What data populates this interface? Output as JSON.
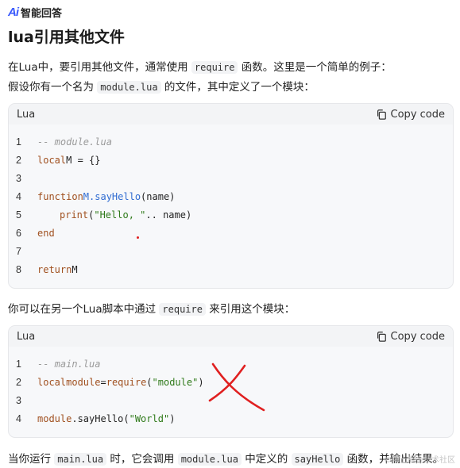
{
  "brand": {
    "logo": "Ai",
    "name": "智能回答"
  },
  "title": "lua引用其他文件",
  "intro": {
    "p1_before": "在Lua中，要引用其他文件，通常使用 ",
    "p1_code": "require",
    "p1_after": " 函数。这里是一个简单的例子：",
    "p2_before": "假设你有一个名为 ",
    "p2_code": "module.lua",
    "p2_after": " 的文件，其中定义了一个模块："
  },
  "code_block_1": {
    "language": "Lua",
    "copy_label": "Copy code",
    "line_numbers": [
      "1",
      "2",
      "3",
      "4",
      "5",
      "6",
      "7",
      "8"
    ],
    "l1": "-- module.lua",
    "l2_kw": "local",
    "l2_rest": " M = {}",
    "l4_kw": "function",
    "l4_fn": " M.sayHello",
    "l4_rest": "(name)",
    "l5_fn": "print",
    "l5_open": "(",
    "l5_str": "\"Hello, \"",
    "l5_rest": " .. name)",
    "l6_kw": "end",
    "l8_kw": "return",
    "l8_rest": " M"
  },
  "middle": {
    "before": "你可以在另一个Lua脚本中通过 ",
    "code": "require",
    "after": " 来引用这个模块："
  },
  "code_block_2": {
    "language": "Lua",
    "copy_label": "Copy code",
    "line_numbers": [
      "1",
      "2",
      "3",
      "4"
    ],
    "l1": "-- main.lua",
    "l2_kw": "local",
    "l2_var": " module",
    "l2_eq": " = ",
    "l2_fn": "require",
    "l2_open": "(",
    "l2_str": "\"module\"",
    "l2_close": ")",
    "l4_var": "module",
    "l4_mid": ".sayHello(",
    "l4_str": "\"World\"",
    "l4_close": ")"
  },
  "footer": {
    "before": "当你运行 ",
    "code1": "main.lua",
    "mid1": " 时，它会调用 ",
    "code2": "module.lua",
    "mid2": " 中定义的 ",
    "code3": "sayHello",
    "after": " 函数，并输出结果。"
  },
  "watermark": "©稀土掘金技术社区",
  "colors": {
    "accent": "#3b5bfd",
    "annotation": "#e02020"
  }
}
